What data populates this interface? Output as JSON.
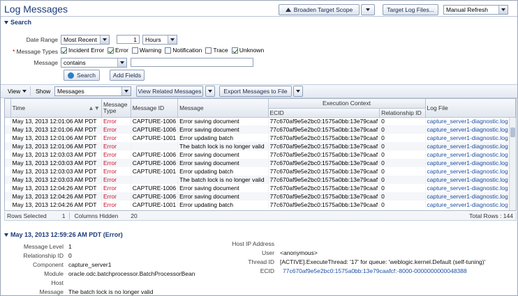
{
  "header": {
    "title": "Log Messages",
    "broaden_label": "Broaden Target Scope",
    "target_log_files_label": "Target Log Files...",
    "refresh_value": "Manual Refresh"
  },
  "search": {
    "heading": "Search",
    "date_range_label": "Date Range",
    "date_range_value": "Most Recent",
    "count_value": "1",
    "unit_value": "Hours",
    "message_types_label": "Message Types",
    "types": [
      {
        "label": "Incident Error",
        "checked": true
      },
      {
        "label": "Error",
        "checked": true
      },
      {
        "label": "Warning",
        "checked": false
      },
      {
        "label": "Notification",
        "checked": false
      },
      {
        "label": "Trace",
        "checked": false
      },
      {
        "label": "Unknown",
        "checked": true
      }
    ],
    "message_label": "Message",
    "message_operator": "contains",
    "message_value": "",
    "search_button": "Search",
    "add_fields_button": "Add Fields"
  },
  "toolbar": {
    "view_label": "View",
    "show_label": "Show",
    "show_value": "Messages",
    "view_related_label": "View Related Messages",
    "export_label": "Export Messages to File"
  },
  "table": {
    "group_header": "Execution Context",
    "columns": {
      "time": "Time",
      "type": "Message Type",
      "id": "Message ID",
      "message": "Message",
      "ecid": "ECID",
      "rel": "Relationship ID",
      "log": "Log File"
    },
    "rows": [
      {
        "time": "May 13, 2013 12:01:06 AM PDT",
        "type": "Error",
        "id": "CAPTURE-1006",
        "message": "Error saving document",
        "ecid": "77c670af9e5e2bc0:1575a0bb:13e79caaf",
        "rel": "0",
        "log": "capture_server1-diagnostic.log"
      },
      {
        "time": "May 13, 2013 12:01:06 AM PDT",
        "type": "Error",
        "id": "CAPTURE-1006",
        "message": "Error saving document",
        "ecid": "77c670af9e5e2bc0:1575a0bb:13e79caaf",
        "rel": "0",
        "log": "capture_server1-diagnostic.log"
      },
      {
        "time": "May 13, 2013 12:01:06 AM PDT",
        "type": "Error",
        "id": "CAPTURE-1001",
        "message": "Error updating batch",
        "ecid": "77c670af9e5e2bc0:1575a0bb:13e79caaf",
        "rel": "0",
        "log": "capture_server1-diagnostic.log"
      },
      {
        "time": "May 13, 2013 12:01:06 AM PDT",
        "type": "Error",
        "id": "",
        "message": "The batch lock is no longer valid",
        "ecid": "77c670af9e5e2bc0:1575a0bb:13e79caaf",
        "rel": "0",
        "log": "capture_server1-diagnostic.log"
      },
      {
        "time": "May 13, 2013 12:03:03 AM PDT",
        "type": "Error",
        "id": "CAPTURE-1006",
        "message": "Error saving document",
        "ecid": "77c670af9e5e2bc0:1575a0bb:13e79caaf",
        "rel": "0",
        "log": "capture_server1-diagnostic.log"
      },
      {
        "time": "May 13, 2013 12:03:03 AM PDT",
        "type": "Error",
        "id": "CAPTURE-1006",
        "message": "Error saving document",
        "ecid": "77c670af9e5e2bc0:1575a0bb:13e79caaf",
        "rel": "0",
        "log": "capture_server1-diagnostic.log"
      },
      {
        "time": "May 13, 2013 12:03:03 AM PDT",
        "type": "Error",
        "id": "CAPTURE-1001",
        "message": "Error updating batch",
        "ecid": "77c670af9e5e2bc0:1575a0bb:13e79caaf",
        "rel": "0",
        "log": "capture_server1-diagnostic.log"
      },
      {
        "time": "May 13, 2013 12:03:03 AM PDT",
        "type": "Error",
        "id": "",
        "message": "The batch lock is no longer valid",
        "ecid": "77c670af9e5e2bc0:1575a0bb:13e79caaf",
        "rel": "0",
        "log": "capture_server1-diagnostic.log"
      },
      {
        "time": "May 13, 2013 12:04:26 AM PDT",
        "type": "Error",
        "id": "CAPTURE-1006",
        "message": "Error saving document",
        "ecid": "77c670af9e5e2bc0:1575a0bb:13e79caaf",
        "rel": "0",
        "log": "capture_server1-diagnostic.log"
      },
      {
        "time": "May 13, 2013 12:04:26 AM PDT",
        "type": "Error",
        "id": "CAPTURE-1006",
        "message": "Error saving document",
        "ecid": "77c670af9e5e2bc0:1575a0bb:13e79caaf",
        "rel": "0",
        "log": "capture_server1-diagnostic.log"
      },
      {
        "time": "May 13, 2013 12:04:26 AM PDT",
        "type": "Error",
        "id": "CAPTURE-1001",
        "message": "Error updating batch",
        "ecid": "77c670af9e5e2bc0:1575a0bb:13e79caaf",
        "rel": "0",
        "log": "capture_server1-diagnostic.log"
      }
    ]
  },
  "status": {
    "rows_selected_label": "Rows Selected",
    "rows_selected_value": "1",
    "columns_hidden_label": "Columns Hidden",
    "columns_hidden_value": "20",
    "total_rows": "Total Rows : 144"
  },
  "detail": {
    "heading": "May 13, 2013 12:59:26 AM PDT (Error)",
    "left": [
      {
        "label": "Message Level",
        "value": "1"
      },
      {
        "label": "Relationship ID",
        "value": "0"
      },
      {
        "label": "Component",
        "value": "capture_server1"
      },
      {
        "label": "Module",
        "value": "oracle.odc.batchprocessor.BatchProcessorBean"
      },
      {
        "label": "Host",
        "value": ""
      },
      {
        "label": "Message",
        "value": "The batch lock is no longer valid"
      }
    ],
    "right": [
      {
        "label": "Host IP Address",
        "value": ""
      },
      {
        "label": "User",
        "value": "<anonymous>"
      },
      {
        "label": "Thread ID",
        "value": "[ACTIVE].ExecuteThread: '17' for queue: 'weblogic.kernel.Default (self-tuning)'"
      },
      {
        "label": "ECID",
        "value": "77c670af9e5e2bc0:1575a0bb:13e79caafcf:-8000-0000000000048388"
      }
    ]
  },
  "colors": {
    "title": "#1a3a78",
    "error": "#c8102e",
    "link": "#1f4fa0"
  }
}
